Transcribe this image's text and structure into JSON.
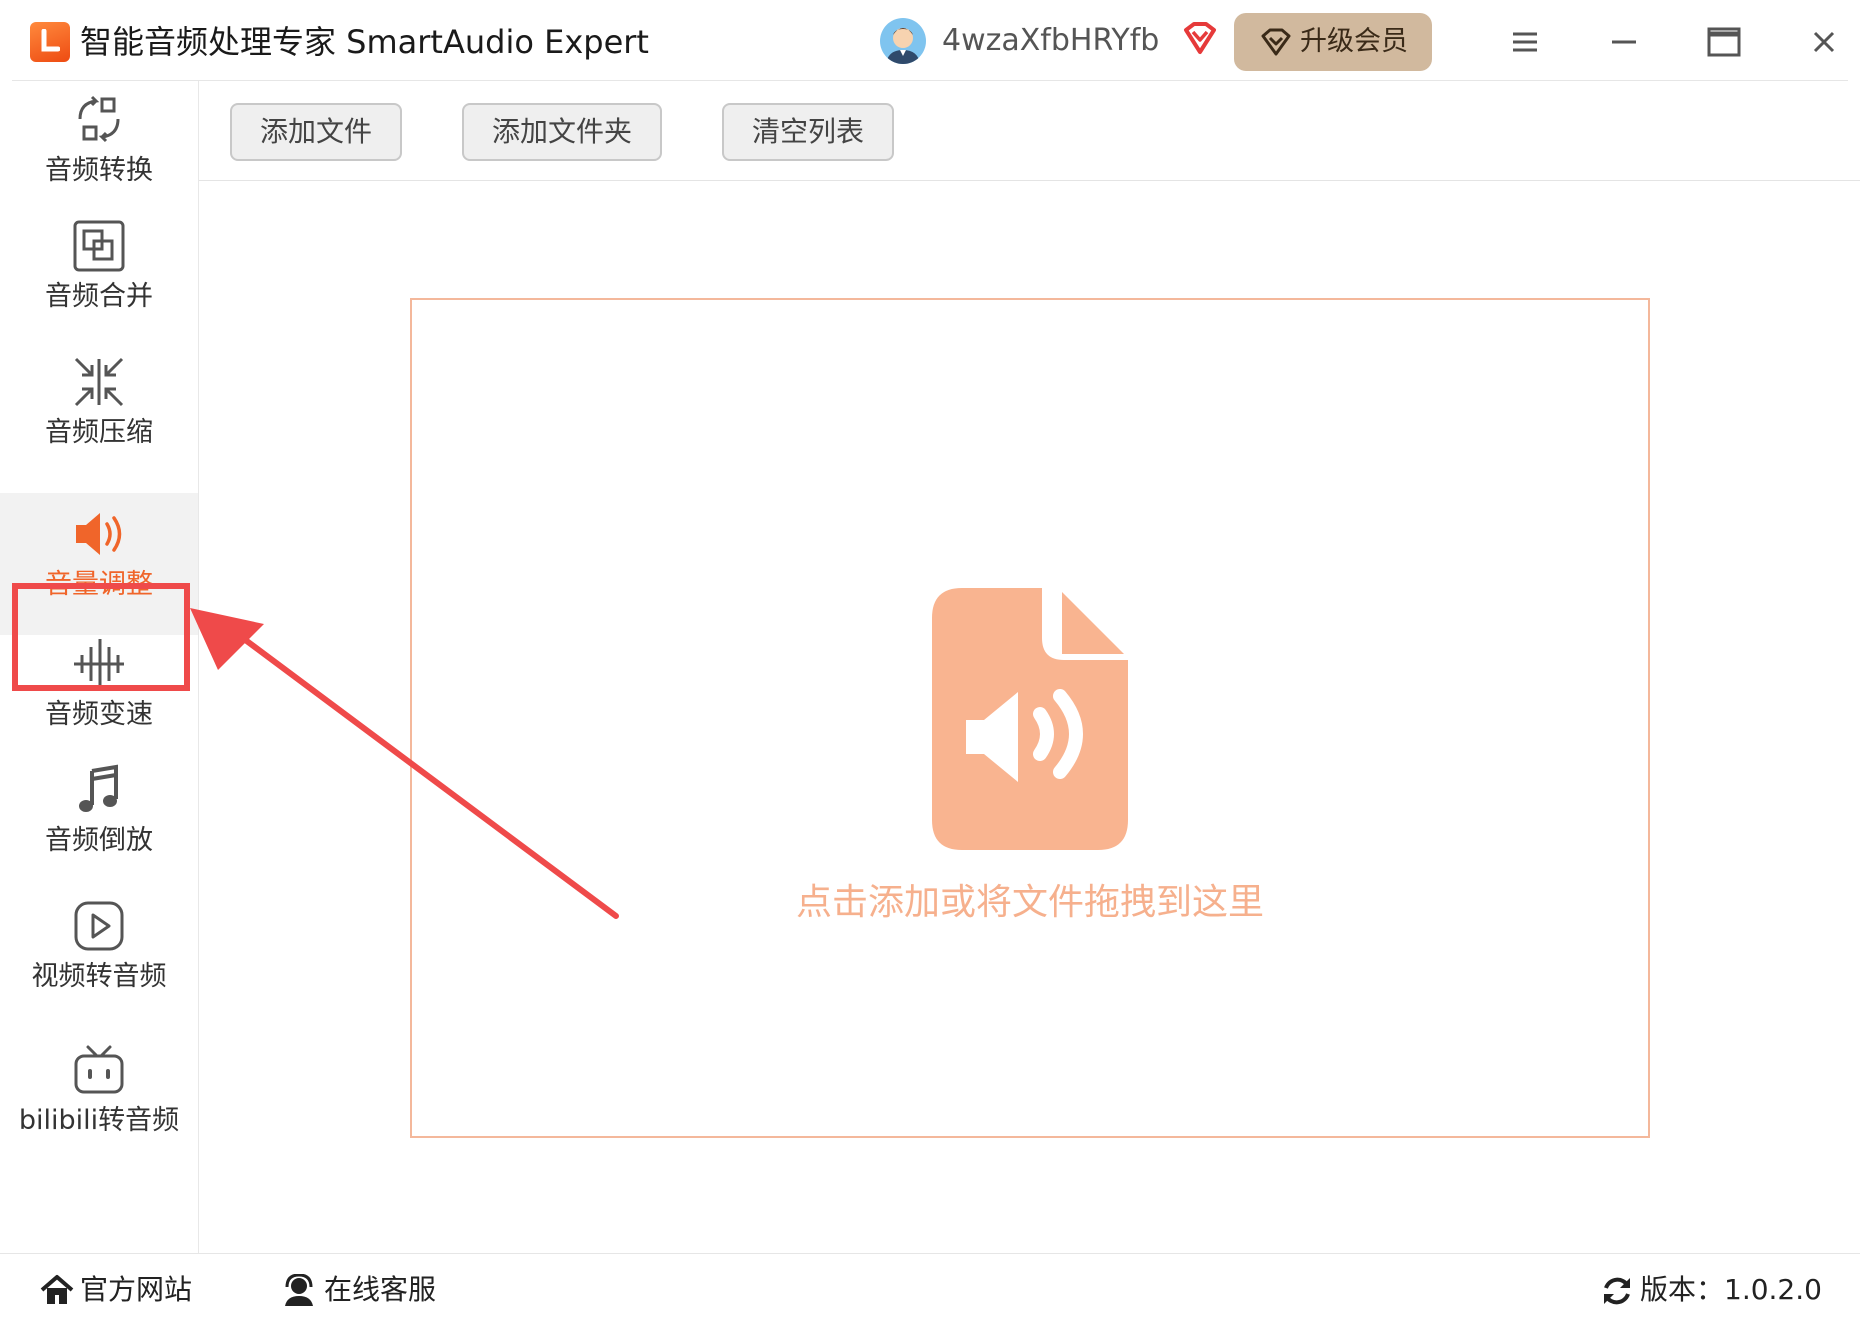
{
  "window": {
    "title": "智能音频处理专家 SmartAudio Expert",
    "username": "4wzaXfbHRYfb",
    "upgrade_label": "升级会员",
    "accent_color": "#f0652a",
    "controls": [
      "menu-icon",
      "minimize-icon",
      "maximize-icon",
      "close-icon"
    ]
  },
  "sidebar": {
    "items": [
      {
        "label": "音频转换",
        "icon": "convert-icon",
        "active": false
      },
      {
        "label": "音频合并",
        "icon": "merge-icon",
        "active": false
      },
      {
        "label": "音频压缩",
        "icon": "compress-icon",
        "active": false
      },
      {
        "label": "音量调整",
        "icon": "speaker-icon",
        "active": true
      },
      {
        "label": "音频变速",
        "icon": "waveform-icon",
        "active": false
      },
      {
        "label": "音频倒放",
        "icon": "music-note-icon",
        "active": false
      },
      {
        "label": "视频转音频",
        "icon": "play-icon",
        "active": false
      },
      {
        "label": "bilibili转音频",
        "icon": "tv-icon",
        "active": false
      }
    ]
  },
  "toolbar": {
    "add_file": "添加文件",
    "add_folder": "添加文件夹",
    "clear_list": "清空列表"
  },
  "dropzone": {
    "hint": "点击添加或将文件拖拽到这里",
    "icon": "audio-file-icon"
  },
  "statusbar": {
    "website": "官方网站",
    "support": "在线客服",
    "version": "版本：1.0.2.0"
  }
}
